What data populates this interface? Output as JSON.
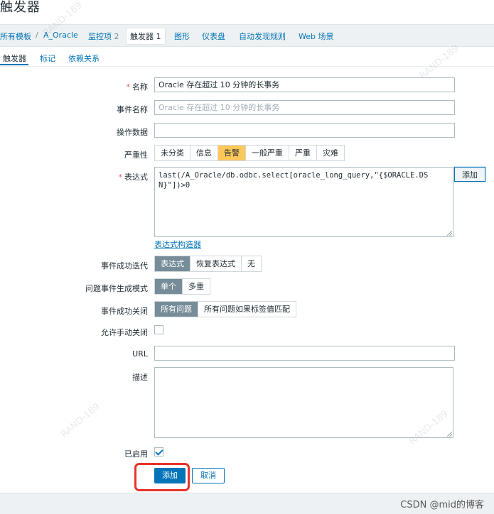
{
  "page": {
    "title": "触发器"
  },
  "breadcrumb": {
    "all_templates": "所有模板",
    "separator": "/",
    "template": "A_Oracle",
    "items_label": "监控项",
    "items_count": "2",
    "triggers_label": "触发器",
    "triggers_count": "1",
    "graphs": "图形",
    "dashboards": "仪表盘",
    "discovery": "自动发现规则",
    "web": "Web 场景"
  },
  "tabs": [
    "触发器",
    "标记",
    "依赖关系"
  ],
  "form": {
    "name": {
      "label": "名称",
      "value": "Oracle 存在超过 10 分钟的长事务"
    },
    "event_name": {
      "label": "事件名称",
      "placeholder": "Oracle 存在超过 10 分钟的长事务"
    },
    "opdata": {
      "label": "操作数据",
      "value": ""
    },
    "severity": {
      "label": "严重性",
      "options": [
        "未分类",
        "信息",
        "告警",
        "一般严重",
        "严重",
        "灾难"
      ],
      "selected": "告警",
      "selected_color": "#ffc859"
    },
    "expression": {
      "label": "表达式",
      "value": "last(/A_Oracle/db.odbc.select[oracle_long_query,\"{$ORACLE.DSN}\"])>0",
      "add_button": "添加",
      "builder_link": "表达式构造器"
    },
    "ok_event_generation": {
      "label": "事件成功迭代",
      "options": [
        "表达式",
        "恢复表达式",
        "无"
      ],
      "selected": "表达式"
    },
    "problem_event_mode": {
      "label": "问题事件生成模式",
      "options": [
        "单个",
        "多重"
      ],
      "selected": "单个"
    },
    "ok_event_closes": {
      "label": "事件成功关闭",
      "options": [
        "所有问题",
        "所有问题如果标签值匹配"
      ],
      "selected": "所有问题"
    },
    "allow_manual_close": {
      "label": "允许手动关闭",
      "checked": false
    },
    "url": {
      "label": "URL",
      "value": ""
    },
    "description": {
      "label": "描述",
      "value": ""
    },
    "enabled": {
      "label": "已启用",
      "checked": true
    },
    "buttons": {
      "add": "添加",
      "cancel": "取消"
    }
  },
  "watermark": {
    "csdn": "CSDN @mid的博客",
    "bg": "RAND-189"
  },
  "colors": {
    "accent": "#0275b8",
    "highlight": "#e8332a",
    "selected_segment": "#768d99"
  }
}
